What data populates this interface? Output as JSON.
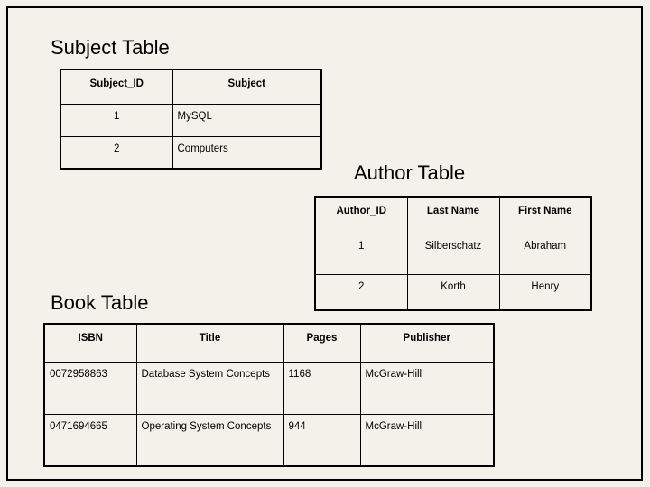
{
  "slide": {
    "background_color": "#F4F1EA",
    "border_color": "#000000"
  },
  "tables": {
    "subject": {
      "title": "Subject Table",
      "columns": [
        "Subject_ID",
        "Subject"
      ],
      "rows": [
        [
          "1",
          "MySQL"
        ],
        [
          "2",
          "Computers"
        ]
      ]
    },
    "author": {
      "title": "Author Table",
      "columns": [
        "Author_ID",
        "Last Name",
        "First Name"
      ],
      "rows": [
        [
          "1",
          "Silberschatz",
          "Abraham"
        ],
        [
          "2",
          "Korth",
          "Henry"
        ]
      ]
    },
    "book": {
      "title": "Book Table",
      "columns": [
        "ISBN",
        "Title",
        "Pages",
        "Publisher"
      ],
      "rows": [
        [
          "0072958863",
          "Database System Concepts",
          "1168",
          "McGraw-Hill"
        ],
        [
          "0471694665",
          "Operating System Concepts",
          "944",
          "McGraw-Hill"
        ]
      ]
    }
  }
}
